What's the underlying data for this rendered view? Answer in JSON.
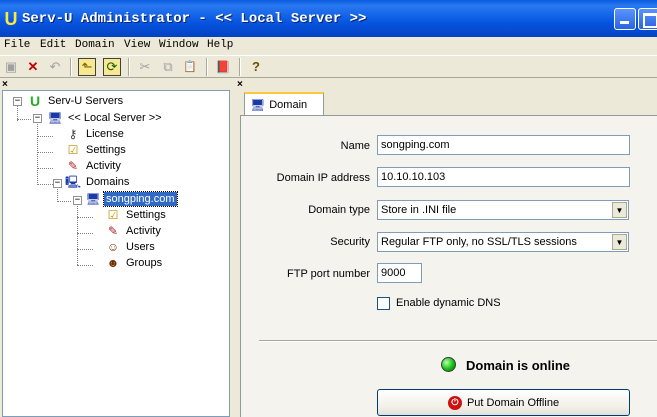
{
  "window": {
    "title": "Serv-U Administrator - << Local Server >>",
    "title_icon": "U"
  },
  "menu": [
    "File",
    "Edit",
    "Domain",
    "View",
    "Window",
    "Help"
  ],
  "toolbar": {
    "icons": [
      "save-icon",
      "delete-icon",
      "undo-icon",
      "up-folder-icon",
      "refresh-icon",
      "cut-icon",
      "copy-icon",
      "paste-icon",
      "book-icon",
      "help-icon"
    ],
    "save": "▣",
    "delete": "✕",
    "undo": "↶",
    "up": "⬑",
    "refresh": "⟳",
    "cut": "✂",
    "copy": "⧉",
    "paste": "📋",
    "book": "📕",
    "help": "?"
  },
  "tree": {
    "close": "×",
    "root": "Serv-U Servers",
    "server": "<< Local Server >>",
    "license": "License",
    "settings": "Settings",
    "activity": "Activity",
    "domains": "Domains",
    "domain": "songping.com",
    "d_settings": "Settings",
    "d_activity": "Activity",
    "d_users": "Users",
    "d_groups": "Groups",
    "expanded": "−"
  },
  "detail": {
    "close": "×",
    "tab": "Domain",
    "name_label": "Name",
    "name_value": "songping.com",
    "ip_label": "Domain IP address",
    "ip_value": "10.10.10.103",
    "type_label": "Domain type",
    "type_value": "Store in .INI file",
    "security_label": "Security",
    "security_value": "Regular FTP only, no SSL/TLS sessions",
    "port_label": "FTP port number",
    "port_value": "9000",
    "dns_label": "Enable dynamic DNS",
    "status_text": "Domain is online",
    "offline_button": "Put Domain Offline"
  },
  "colors": {
    "titlebar": "#0655e0",
    "selection": "#316ac5",
    "status_online": "#10c010"
  }
}
